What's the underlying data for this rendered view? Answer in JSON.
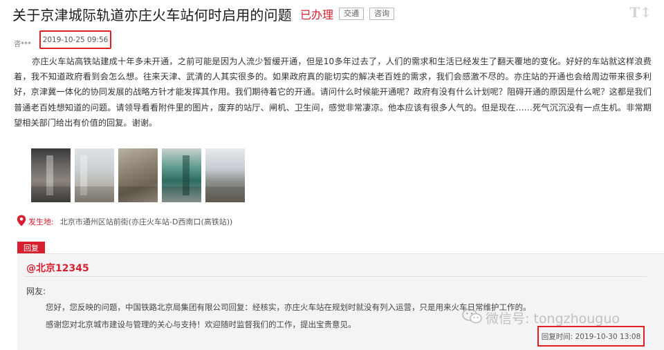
{
  "header": {
    "title": "关于京津城际轨道亦庄火车站何时启用的问题",
    "status": "已办理",
    "tags": [
      "交通",
      "咨询"
    ],
    "font_toggle": "T↕"
  },
  "meta": {
    "user": "咨***",
    "date": "2019-10-25 09:56"
  },
  "body": "亦庄火车站高铁站建成十年多未开通，之前可能是因为人流少暂缓开通，但是10多年过去了，人们的需求和生活已经发生了翻天覆地的变化。好好的车站就这样浪费着，我不知道政府看到会怎么想。往来天津、武清的人其实很多的。如果政府真的能切实的解决老百姓的需求，我们会感激不尽的。亦庄站的开通也会给周边带来很多利好，京津冀一体化的协同发展的战略方针才能发挥其作用。我们期待着它的开通。请问什么时候能开通呢？政府有没有什么计划呢？阻碍开通的原因是什么呢？这都是我们普通老百姓想知道的问题。请领导看看附件里的图片，废弃的站厅、闸机、卫生间，感觉非常凄凉。他本应该有很多人气的。但是现在……死气沉沉没有一点生机。非常期望相关部门给出有价值的回复。谢谢。",
  "location": {
    "label": "发生地:",
    "value": "北京市通州区站前街(亦庄火车站-D西南口(高铁站))"
  },
  "reply": {
    "tab_label": "回复",
    "author": "@北京12345",
    "greeting": "网友:",
    "line1": "您好，您反映的问题，中国铁路北京局集团有限公司回复：经核实，亦庄火车站在规划时就没有列入运营，只是用来火车日常维护工作的。",
    "line2": "感谢您对北京城市建设与管理的关心与支持！欢迎随时监督我们的工作，提出宝贵意见。",
    "time": "回复时间: 2019-10-30 13:08"
  },
  "watermark": "微信号: tongzhouguo",
  "colors": {
    "accent": "#d6202f",
    "highlight_box": "#e02020",
    "reply_bg": "#f4f4f6"
  },
  "icons": {
    "location": "map-pin-icon",
    "watermark": "wechat-icon"
  }
}
